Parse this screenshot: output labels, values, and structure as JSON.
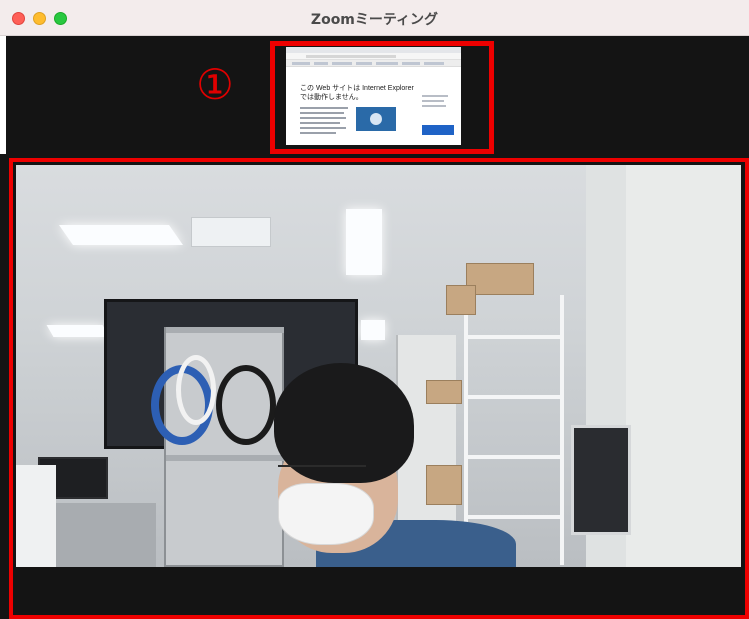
{
  "window": {
    "title": "Zoomミーティング",
    "buttons": [
      "close",
      "minimize",
      "maximize"
    ]
  },
  "callout": {
    "label": "①",
    "color": "#ee0000"
  },
  "shared_screen": {
    "headline_line1": "この Web サイトは Internet Explorer",
    "headline_line2": "では動作しません。"
  },
  "colors": {
    "highlight": "#ee0000",
    "strip_background": "#141414",
    "titlebar": "#f3ecec"
  },
  "icons": {
    "close": "close-dot-icon",
    "minimize": "minimize-dot-icon",
    "maximize": "maximize-dot-icon"
  }
}
